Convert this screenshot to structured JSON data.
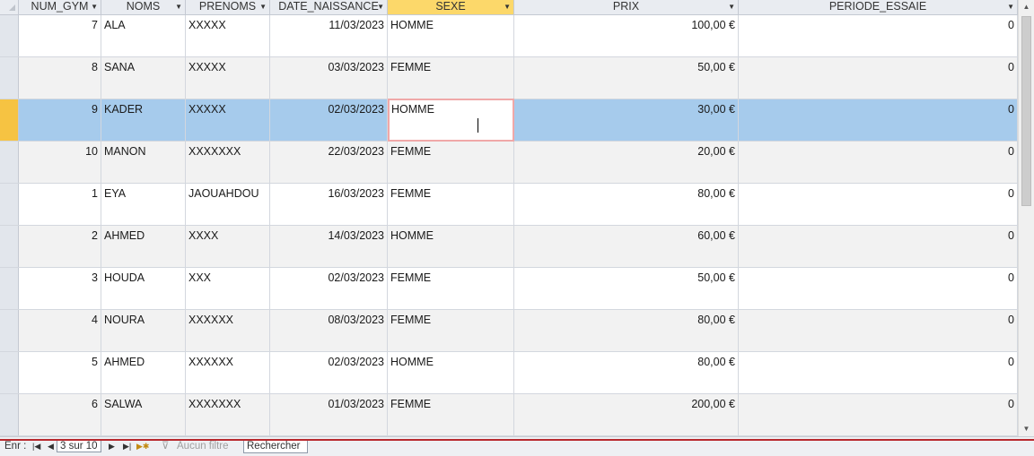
{
  "columns": [
    {
      "label": "NUM_GYM",
      "align": "right"
    },
    {
      "label": "NOMS",
      "align": "left"
    },
    {
      "label": "PRENOMS",
      "align": "left"
    },
    {
      "label": "DATE_NAISSANCE",
      "align": "right"
    },
    {
      "label": "SEXE",
      "align": "left"
    },
    {
      "label": "PRIX",
      "align": "right"
    },
    {
      "label": "PERIODE_ESSAIE",
      "align": "right"
    }
  ],
  "active_column": "SEXE",
  "rows": [
    [
      "7",
      "ALA",
      "XXXXX",
      "11/03/2023",
      "HOMME",
      "100,00 €",
      "0"
    ],
    [
      "8",
      "SANA",
      "XXXXX",
      "03/03/2023",
      "FEMME",
      "50,00 €",
      "0"
    ],
    [
      "9",
      "KADER",
      "XXXXX",
      "02/03/2023",
      "HOMME",
      "30,00 €",
      "0"
    ],
    [
      "10",
      "MANON",
      "XXXXXXX",
      "22/03/2023",
      "FEMME",
      "20,00 €",
      "0"
    ],
    [
      "1",
      "EYA",
      "JAOUAHDOU",
      "16/03/2023",
      "FEMME",
      "80,00 €",
      "0"
    ],
    [
      "2",
      "AHMED",
      "XXXX",
      "14/03/2023",
      "HOMME",
      "60,00 €",
      "0"
    ],
    [
      "3",
      "HOUDA",
      "XXX",
      "02/03/2023",
      "FEMME",
      "50,00 €",
      "0"
    ],
    [
      "4",
      "NOURA",
      "XXXXXX",
      "08/03/2023",
      "FEMME",
      "80,00 €",
      "0"
    ],
    [
      "5",
      "AHMED",
      "XXXXXX",
      "02/03/2023",
      "HOMME",
      "80,00 €",
      "0"
    ],
    [
      "6",
      "SALWA",
      "XXXXXXX",
      "01/03/2023",
      "FEMME",
      "200,00 €",
      "0"
    ]
  ],
  "selected_row": 2,
  "navigation": {
    "record_label": "Enr :",
    "first_icon": "first-record-icon",
    "prev_icon": "previous-record-icon",
    "record_position": "3 sur 10",
    "next_icon": "next-record-icon",
    "last_icon": "last-record-icon",
    "new_icon": "new-record-icon",
    "filter_icon": "filter-off-icon",
    "filter_label": "Aucun filtre",
    "search_label": "Rechercher"
  },
  "colors": {
    "selected_row": "#a6cbec",
    "active_header": "#fcd86a",
    "row_selector_active": "#f6c342",
    "focus_border": "#f0a8a8"
  }
}
